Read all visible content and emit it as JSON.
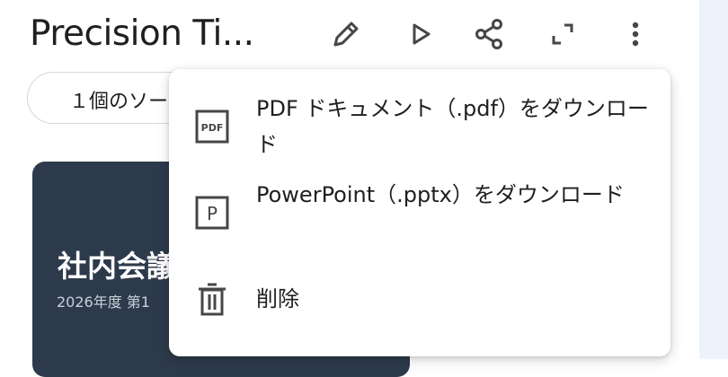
{
  "header": {
    "title": "Precision Ti...",
    "toolbar": {
      "edit_icon": "pencil-icon",
      "play_icon": "play-icon",
      "share_icon": "share-icon",
      "fullscreen_icon": "fullscreen-icon",
      "more_icon": "more-vert-icon"
    }
  },
  "sources_chip": {
    "label": "１個のソー"
  },
  "slide": {
    "title": "社内会議",
    "subtitle": "2026年度 第1"
  },
  "menu": {
    "items": [
      {
        "icon": "pdf-icon",
        "label": "PDF ドキュメント（.pdf）をダウンロード"
      },
      {
        "icon": "powerpoint-icon",
        "label": "PowerPoint（.pptx）をダウンロード"
      },
      {
        "icon": "trash-icon",
        "label": "削除"
      }
    ]
  },
  "colors": {
    "slide_background": "#2d3a4b",
    "side_panel": "#eef3fb",
    "text": "#1f1f1f",
    "icon": "#444746"
  }
}
